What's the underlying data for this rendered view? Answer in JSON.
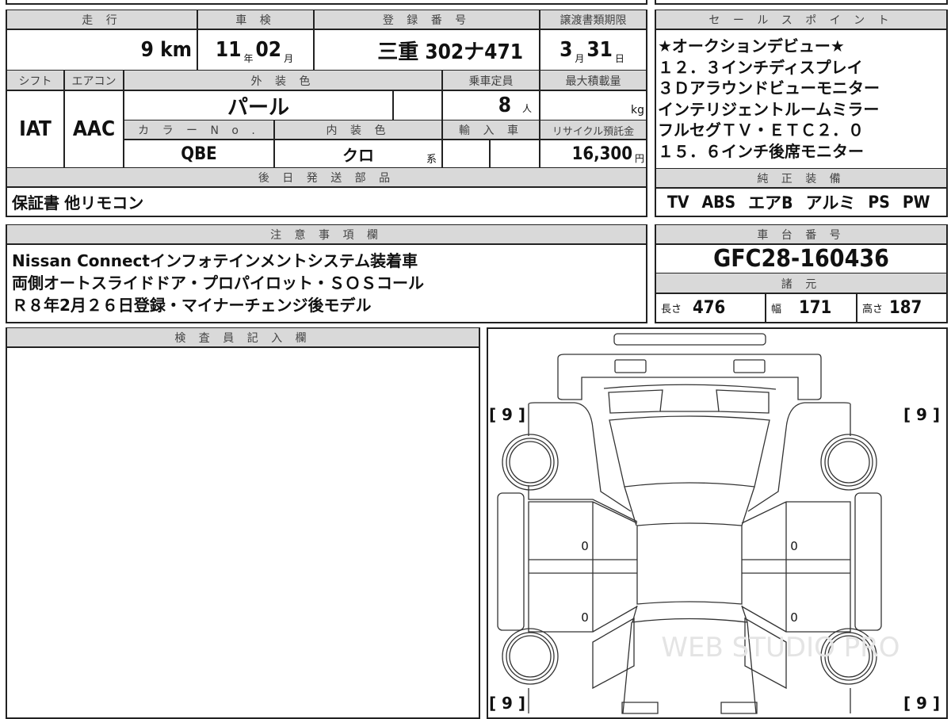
{
  "vehicle": {
    "mileage_label": "走 行",
    "mileage_value": "9",
    "mileage_unit": "km",
    "inspection_label": "車 検",
    "inspection_year": "11",
    "year_unit": "年",
    "inspection_month": "02",
    "month_unit": "月",
    "reg_label": "登 録 番 号",
    "reg_value": "三重 302ナ471",
    "transfer_label": "譲渡書類期限",
    "transfer_month": "3",
    "transfer_day": "31",
    "day_unit": "日",
    "shift_label": "シフト",
    "shift_value": "IAT",
    "ac_label": "エアコン",
    "ac_value": "AAC",
    "exterior_label": "外 装 色",
    "exterior_value": "パール",
    "capacity_label": "乗車定員",
    "capacity_value": "8",
    "capacity_unit": "人",
    "maxload_label": "最大積載量",
    "maxload_unit": "kg",
    "colorno_label": "カ ラ ー N o .",
    "colorno_value": "QBE",
    "interior_label": "内 装 色",
    "interior_value": "クロ",
    "interior_suffix": "系",
    "import_label": "輸 入 車",
    "recycle_label": "リサイクル預託金",
    "recycle_value": "16,300",
    "recycle_unit": "円"
  },
  "later_parts": {
    "label": "後 日 発 送 部 品",
    "value": "保証書 他リモコン"
  },
  "notes": {
    "label": "注 意 事 項 欄",
    "lines": [
      "Nissan  Connectインフォテインメントシステム装着車",
      "両側オートスライドドア・プロパイロット・ＳＯＳコール",
      "Ｒ８年2月２６日登録・マイナーチェンジ後モデル"
    ]
  },
  "inspector": {
    "label": "検 査 員 記 入 欄"
  },
  "sales_points": {
    "label": "セ ー ル ス ポ イ ン ト",
    "lines": [
      "★オークションデビュー★",
      "１２．３インチディスプレイ",
      "３Ｄアラウンドビューモニター",
      "インテリジェントルームミラー",
      "フルセグＴＶ・ＥＴＣ２．０",
      "１５．６インチ後席モニター"
    ]
  },
  "equipment": {
    "label": "純 正 装 備",
    "items": [
      "TV",
      "ABS",
      "エアB",
      "アルミ",
      "PS",
      "PW"
    ]
  },
  "chassis": {
    "label": "車 台 番 号",
    "value": "GFC28-160436"
  },
  "specs": {
    "label": "諸 元",
    "length_label": "長さ",
    "length": "476",
    "width_label": "幅",
    "width": "171",
    "height_label": "高さ",
    "height": "187"
  },
  "diagram": {
    "tire_marks": [
      "[ 9 ]",
      "[ 9 ]",
      "[ 9 ]",
      "[ 9 ]"
    ],
    "door_marks": [
      "0",
      "0",
      "0",
      "0"
    ],
    "watermark": "WEB STUDIO PRO"
  }
}
